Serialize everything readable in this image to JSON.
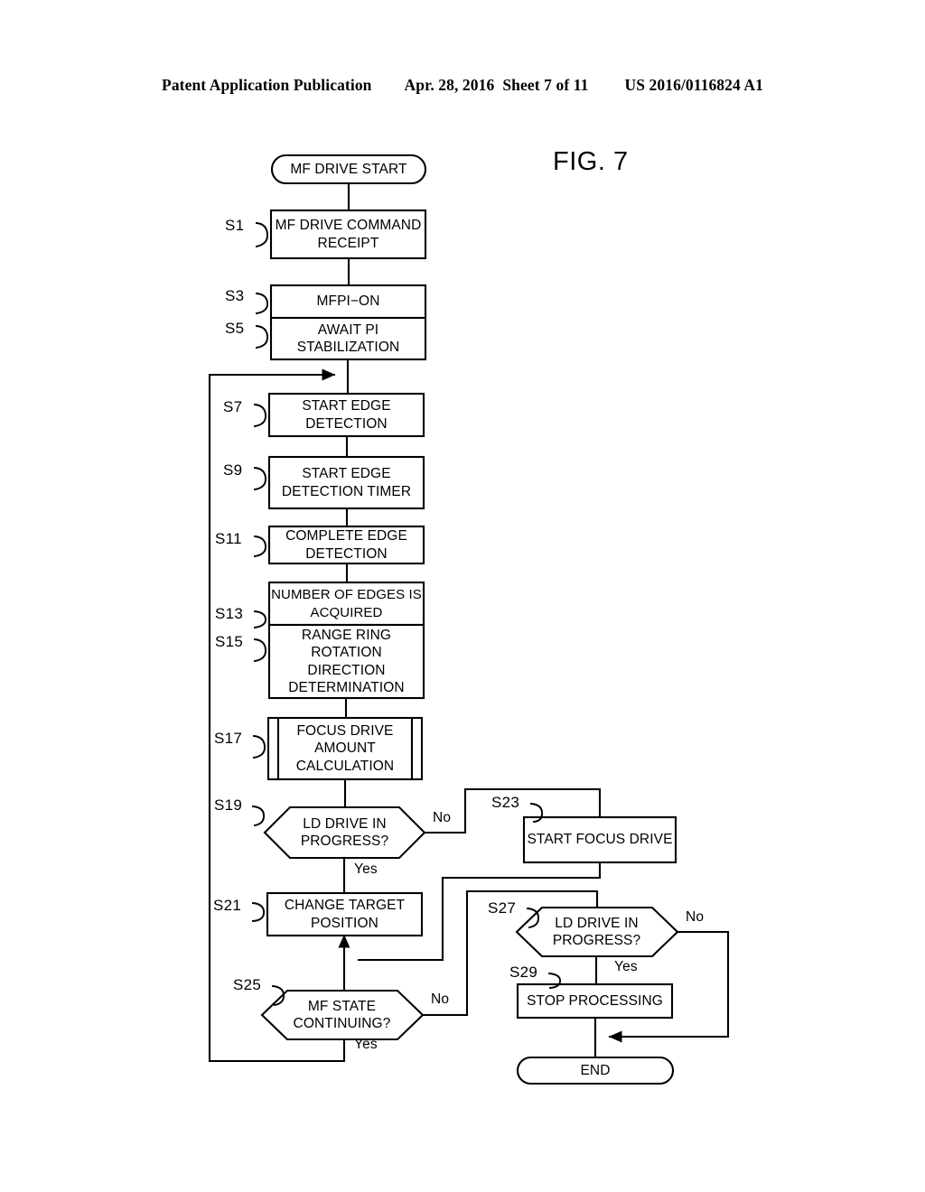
{
  "header": {
    "publication": "Patent Application Publication",
    "date": "Apr. 28, 2016",
    "sheet": "Sheet 7 of 11",
    "number": "US 2016/0116824 A1"
  },
  "figure": {
    "title": "FIG. 7",
    "stroke_color": "#000000",
    "fill_color": "#ffffff"
  },
  "nodes": {
    "start": {
      "id": "start",
      "shape": "terminator",
      "text": "MF DRIVE START"
    },
    "s1": {
      "id": "S1",
      "shape": "process",
      "text": "MF DRIVE COMMAND\nRECEIPT"
    },
    "s3": {
      "id": "S3",
      "shape": "process",
      "text": "MFPI−ON"
    },
    "s5": {
      "id": "S5",
      "shape": "process",
      "text": "AWAIT PI\nSTABILIZATION"
    },
    "s7": {
      "id": "S7",
      "shape": "process",
      "text": "START EDGE\nDETECTION"
    },
    "s9": {
      "id": "S9",
      "shape": "process",
      "text": "START EDGE\nDETECTION TIMER"
    },
    "s11": {
      "id": "S11",
      "shape": "process",
      "text": "COMPLETE EDGE\nDETECTION"
    },
    "s13": {
      "id": "S13",
      "shape": "process",
      "text": "NUMBER OF EDGES IS\nACQUIRED"
    },
    "s15": {
      "id": "S15",
      "shape": "process",
      "text": "RANGE RING\nROTATION\nDIRECTION\nDETERMINATION"
    },
    "s17": {
      "id": "S17",
      "shape": "predefined-process",
      "text": "FOCUS DRIVE\nAMOUNT\nCALCULATION"
    },
    "s19": {
      "id": "S19",
      "shape": "decision",
      "text": "LD DRIVE IN\nPROGRESS?"
    },
    "s21": {
      "id": "S21",
      "shape": "process",
      "text": "CHANGE TARGET\nPOSITION"
    },
    "s23": {
      "id": "S23",
      "shape": "process",
      "text": "START FOCUS DRIVE"
    },
    "s25": {
      "id": "S25",
      "shape": "decision",
      "text": "MF STATE\nCONTINUING?"
    },
    "s27": {
      "id": "S27",
      "shape": "decision",
      "text": "LD DRIVE IN\nPROGRESS?"
    },
    "s29": {
      "id": "S29",
      "shape": "process",
      "text": "STOP PROCESSING"
    },
    "end": {
      "id": "end",
      "shape": "terminator",
      "text": "END"
    }
  },
  "step_labels": {
    "s1": "S1",
    "s3": "S3",
    "s5": "S5",
    "s7": "S7",
    "s9": "S9",
    "s11": "S11",
    "s13": "S13",
    "s15": "S15",
    "s17": "S17",
    "s19": "S19",
    "s21": "S21",
    "s23": "S23",
    "s25": "S25",
    "s27": "S27",
    "s29": "S29"
  },
  "branch_labels": {
    "s19_no": "No",
    "s19_yes": "Yes",
    "s25_no": "No",
    "s25_yes": "Yes",
    "s27_no": "No",
    "s27_yes": "Yes"
  }
}
